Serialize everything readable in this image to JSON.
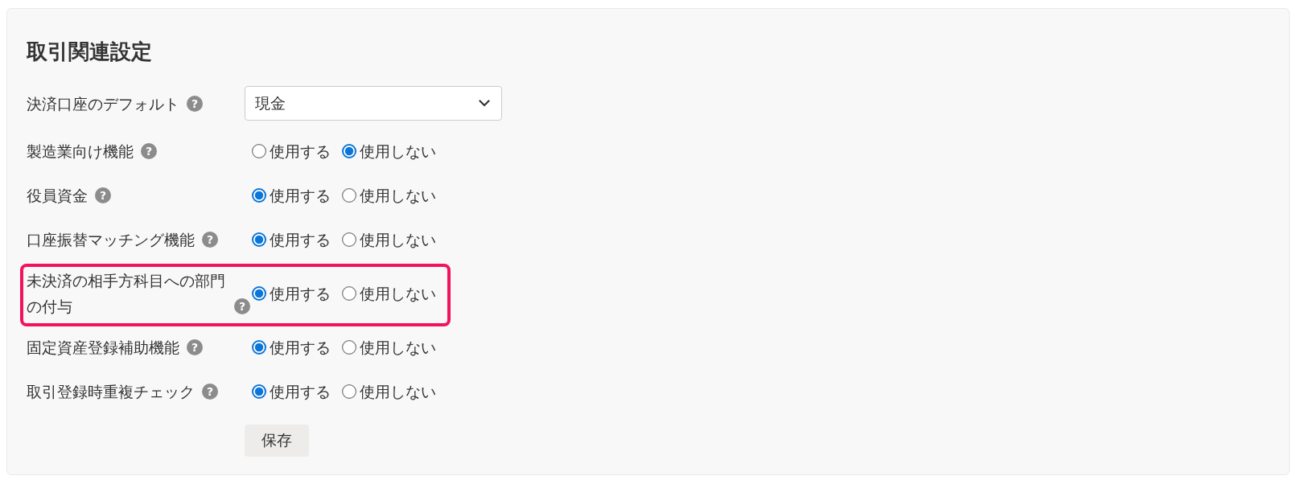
{
  "section": {
    "title": "取引関連設定"
  },
  "rows": [
    {
      "kind": "select",
      "label": "決済口座のデフォルト",
      "help": "?",
      "highlighted": false,
      "value": "現金"
    },
    {
      "kind": "radio",
      "label": "製造業向け機能",
      "help": "?",
      "highlighted": false,
      "options": [
        {
          "label": "使用する",
          "selected": false
        },
        {
          "label": "使用しない",
          "selected": true
        }
      ]
    },
    {
      "kind": "radio",
      "label": "役員資金",
      "help": "?",
      "highlighted": false,
      "options": [
        {
          "label": "使用する",
          "selected": true
        },
        {
          "label": "使用しない",
          "selected": false
        }
      ]
    },
    {
      "kind": "radio",
      "label": "口座振替マッチング機能",
      "help": "?",
      "highlighted": false,
      "options": [
        {
          "label": "使用する",
          "selected": true
        },
        {
          "label": "使用しない",
          "selected": false
        }
      ]
    },
    {
      "kind": "radio",
      "label": "未決済の相手方科目への部門の付与",
      "help": "?",
      "highlighted": true,
      "options": [
        {
          "label": "使用する",
          "selected": true
        },
        {
          "label": "使用しない",
          "selected": false
        }
      ]
    },
    {
      "kind": "radio",
      "label": "固定資産登録補助機能",
      "help": "?",
      "highlighted": false,
      "options": [
        {
          "label": "使用する",
          "selected": true
        },
        {
          "label": "使用しない",
          "selected": false
        }
      ]
    },
    {
      "kind": "radio",
      "label": "取引登録時重複チェック",
      "help": "?",
      "highlighted": false,
      "options": [
        {
          "label": "使用する",
          "selected": true
        },
        {
          "label": "使用しない",
          "selected": false
        }
      ]
    }
  ],
  "save_button": {
    "label": "保存"
  }
}
